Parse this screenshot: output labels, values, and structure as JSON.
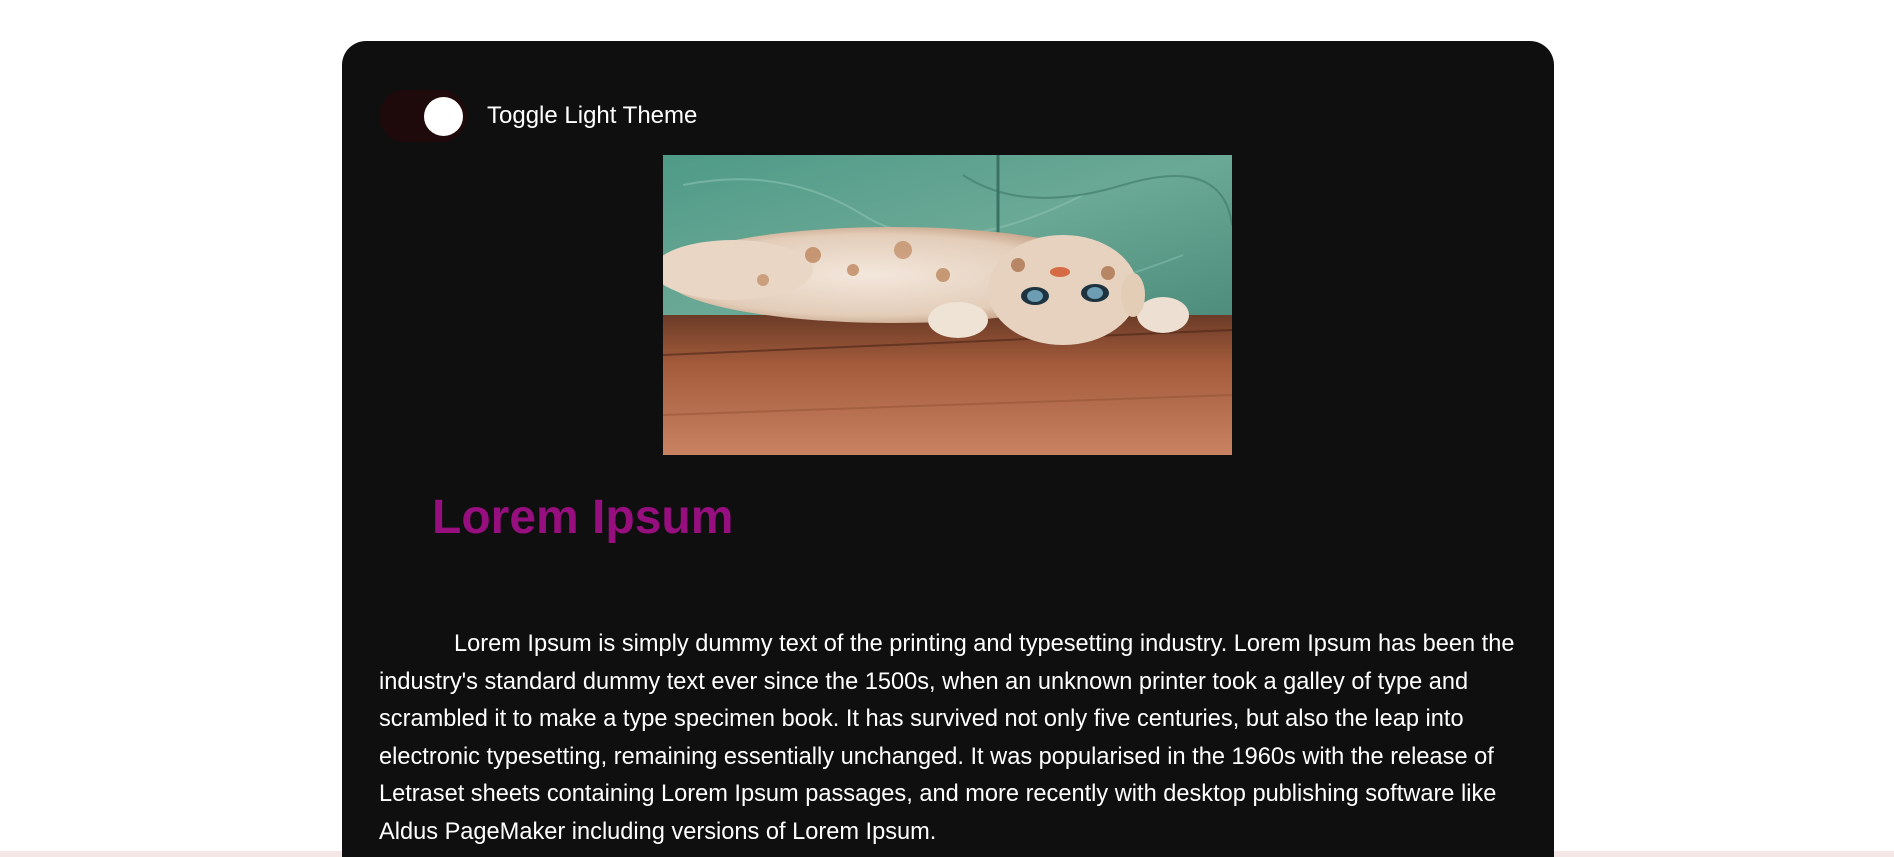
{
  "theme_toggle": {
    "label": "Toggle Light Theme",
    "state": "dark"
  },
  "hero_image": {
    "alt": "cat lying upside down on a wooden floor",
    "icon": "cat-photo"
  },
  "article": {
    "title": "Lorem Ipsum",
    "body": "Lorem Ipsum is simply dummy text of the printing and typesetting industry. Lorem Ipsum has been the industry's standard dummy text ever since the 1500s, when an unknown printer took a galley of type and scrambled it to make a type specimen book. It has survived not only five centuries, but also the leap into electronic typesetting, remaining essentially unchanged. It was popularised in the 1960s with the release of Letraset sheets containing Lorem Ipsum passages, and more recently with desktop publishing software like Aldus PageMaker including versions of Lorem Ipsum."
  },
  "colors": {
    "page_background": "#ffffff",
    "card_background": "#0f0f10",
    "title_color": "#970f7f",
    "text_color": "#ffffff",
    "switch_track": "#1e0a0b",
    "switch_knob": "#ffffff"
  }
}
